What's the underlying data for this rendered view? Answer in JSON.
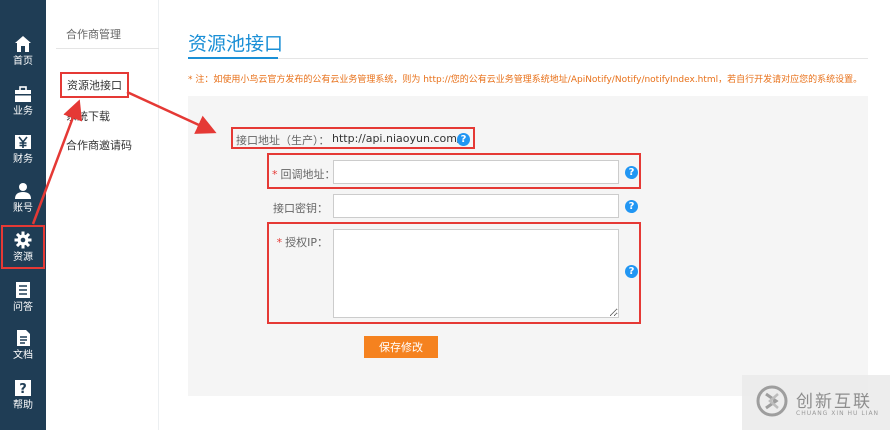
{
  "rail": {
    "items": [
      {
        "label": "首页",
        "icon": "home-icon"
      },
      {
        "label": "业务",
        "icon": "briefcase-icon"
      },
      {
        "label": "财务",
        "icon": "yen-icon"
      },
      {
        "label": "账号",
        "icon": "user-icon"
      },
      {
        "label": "资源",
        "icon": "gear-icon",
        "active": true
      },
      {
        "label": "问答",
        "icon": "list-icon"
      },
      {
        "label": "文档",
        "icon": "document-icon"
      },
      {
        "label": "帮助",
        "icon": "help-icon"
      }
    ]
  },
  "subnav": {
    "heading": "合作商管理",
    "items": [
      {
        "label": "资源池接口",
        "active": true
      },
      {
        "label": "系统下载"
      },
      {
        "label": "合作商邀请码"
      }
    ]
  },
  "page": {
    "title": "资源池接口",
    "notice": "* 注：如使用小鸟云官方发布的公有云业务管理系统，则为 http://您的公有云业务管理系统地址/ApiNotify/Notify/notifyIndex.html，若自行开发请对应您的系统设置。"
  },
  "form": {
    "api_label": "接口地址（生产）：",
    "api_url": "http://api.niaoyun.com/",
    "callback_label": "回调地址：",
    "callback_value": "",
    "secret_label": "接口密钥：",
    "secret_value": "",
    "ip_label": "授权IP：",
    "ip_value": "",
    "help_glyph": "?",
    "required_mark": "*",
    "save_label": "保存修改"
  },
  "watermark": {
    "cn": "创新互联",
    "en": "CHUANG XIN HU LIAN"
  },
  "colors": {
    "rail_bg": "#1f3d55",
    "accent_blue": "#1a8fd6",
    "notice_orange": "#e8711a",
    "button_orange": "#f5821f",
    "highlight_red": "#e53935",
    "help_blue": "#2196f3"
  }
}
